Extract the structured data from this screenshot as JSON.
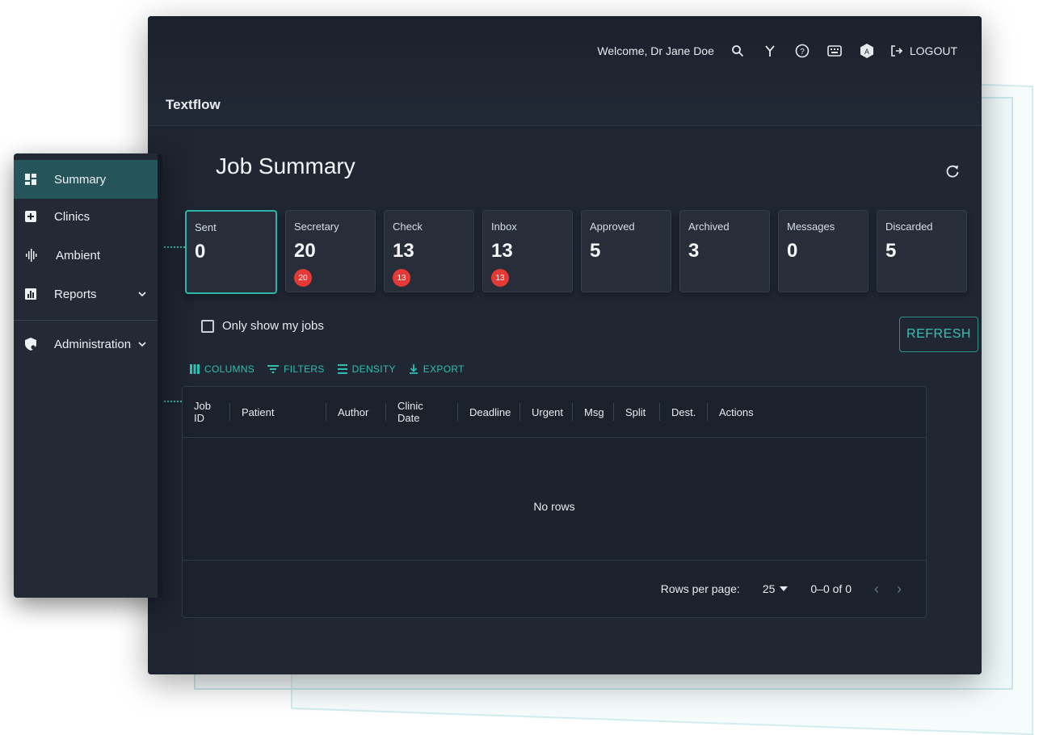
{
  "app": {
    "title": "Textflow"
  },
  "topbar": {
    "welcome": "Welcome, Dr Jane Doe",
    "logout": "LOGOUT"
  },
  "page": {
    "title": "Job Summary"
  },
  "cards": [
    {
      "label": "Sent",
      "count": "0",
      "badge": null
    },
    {
      "label": "Secretary",
      "count": "20",
      "badge": "20"
    },
    {
      "label": "Check",
      "count": "13",
      "badge": "13"
    },
    {
      "label": "Inbox",
      "count": "13",
      "badge": "13"
    },
    {
      "label": "Approved",
      "count": "5",
      "badge": null
    },
    {
      "label": "Archived",
      "count": "3",
      "badge": null
    },
    {
      "label": "Messages",
      "count": "0",
      "badge": null
    },
    {
      "label": "Discarded",
      "count": "5",
      "badge": null
    }
  ],
  "filters": {
    "only_mine": "Only show my jobs",
    "refresh": "REFRESH"
  },
  "toolbar": {
    "columns": "COLUMNS",
    "filters": "FILTERS",
    "density": "DENSITY",
    "export": "EXPORT"
  },
  "grid": {
    "columns": [
      "Job ID",
      "Patient",
      "Author",
      "Clinic Date",
      "Deadline",
      "Urgent",
      "Msg",
      "Split",
      "Dest.",
      "Actions"
    ],
    "empty": "No rows",
    "rows_per_page_label": "Rows per page:",
    "rows_per_page": "25",
    "range": "0–0 of 0"
  },
  "sidebar": {
    "items": [
      {
        "label": "Summary",
        "icon": "dashboard-icon"
      },
      {
        "label": "Clinics",
        "icon": "medical-plus-icon"
      },
      {
        "label": "Ambient",
        "icon": "waveform-icon"
      },
      {
        "label": "Reports",
        "icon": "bar-chart-icon"
      },
      {
        "label": "Administration",
        "icon": "shield-gear-icon"
      }
    ]
  },
  "colors": {
    "accent": "#2fb5a8",
    "badge": "#e53935",
    "active_nav": "#25555a"
  }
}
